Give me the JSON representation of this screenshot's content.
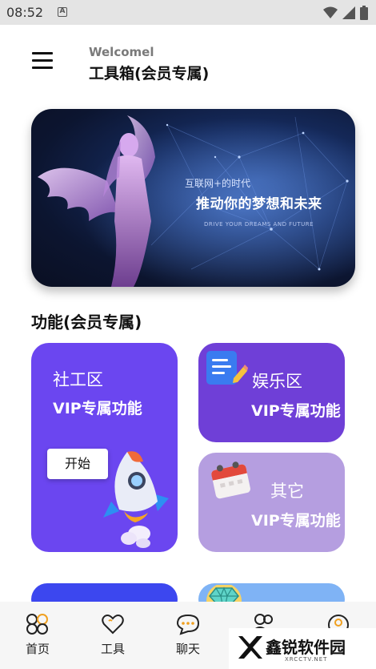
{
  "status_bar": {
    "time": "08:52",
    "notification_icon": "A"
  },
  "header": {
    "welcome": "Welcomel",
    "title": "工具箱(会员专属)"
  },
  "banner": {
    "line1": "互联网+的时代",
    "line2": "推动你的梦想和未来",
    "line3": "DRIVE YOUR DREAMS AND FUTURE"
  },
  "section": {
    "title": "功能(会员专属)"
  },
  "cards": {
    "social": {
      "name": "社工区",
      "sub": "VIP专属功能",
      "button": "开始"
    },
    "entertainment": {
      "name": "娱乐区",
      "sub": "VIP专属功能"
    },
    "other": {
      "name": "其它",
      "sub": "VIP专属功能"
    }
  },
  "tabs": [
    {
      "label": "首页",
      "icon": "home-grid-icon"
    },
    {
      "label": "工具",
      "icon": "heart-icon"
    },
    {
      "label": "聊天",
      "icon": "chat-bubble-icon"
    },
    {
      "label": "",
      "icon": "friends-icon"
    },
    {
      "label": "",
      "icon": "profile-icon"
    }
  ],
  "watermark": {
    "text": "鑫锐软件园",
    "url": "XRCCTV.NET"
  },
  "colors": {
    "card_social": "#6b46f0",
    "card_entertainment": "#6f3fd7",
    "card_other": "#b59ee0",
    "card_peek_blue": "#3c47ef",
    "card_peek_light": "#7fb3f5"
  }
}
